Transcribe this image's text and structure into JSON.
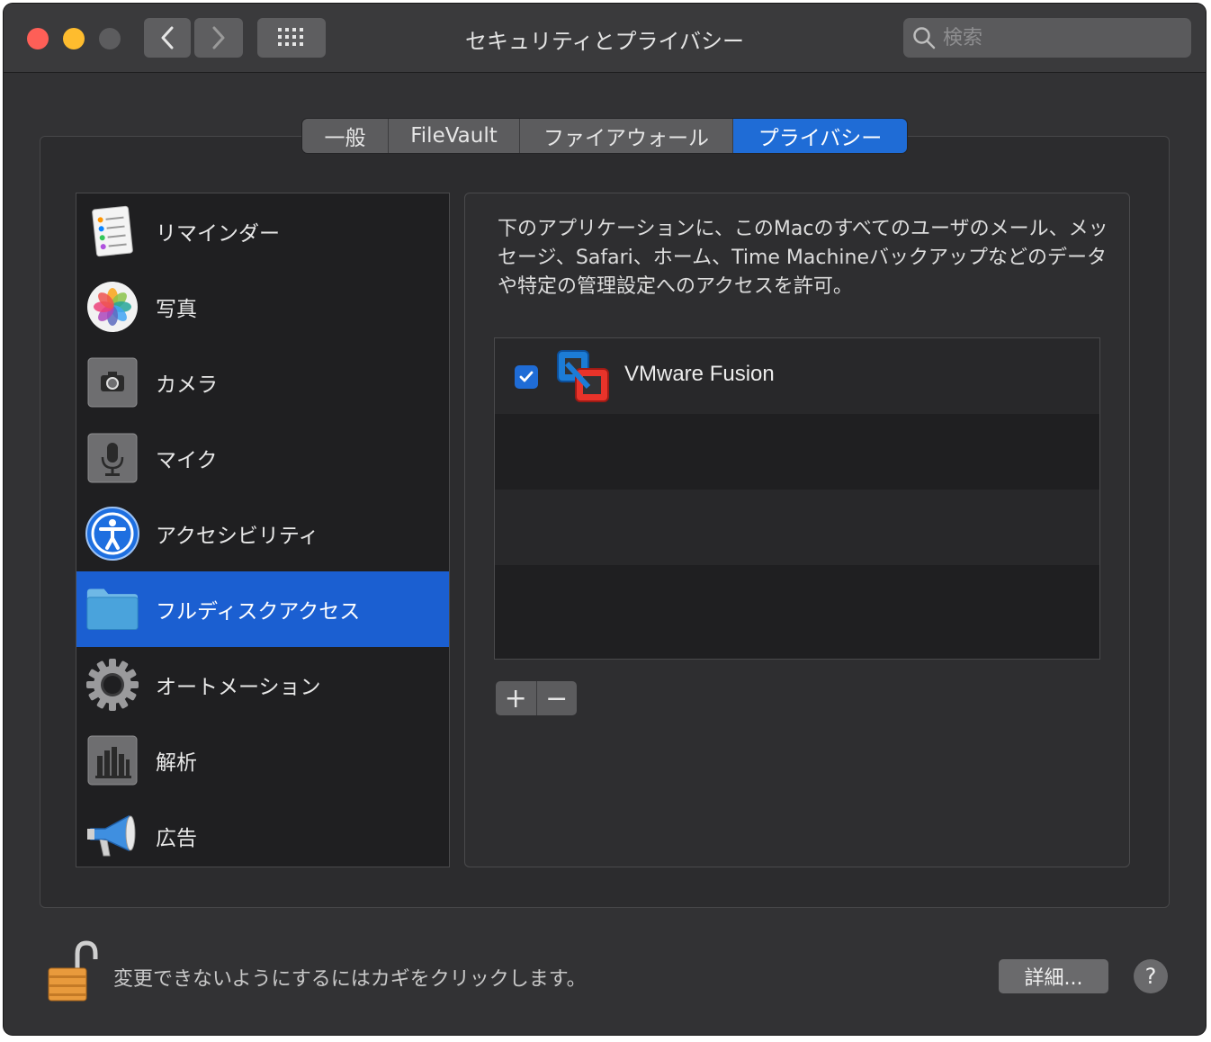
{
  "window": {
    "title": "セキュリティとプライバシー"
  },
  "search": {
    "placeholder": "検索"
  },
  "tabs": [
    {
      "label": "一般"
    },
    {
      "label": "FileVault"
    },
    {
      "label": "ファイアウォール"
    },
    {
      "label": "プライバシー",
      "active": true
    }
  ],
  "sidebar": {
    "items": [
      {
        "label": "リマインダー",
        "icon": "reminders-icon"
      },
      {
        "label": "写真",
        "icon": "photos-icon"
      },
      {
        "label": "カメラ",
        "icon": "camera-icon"
      },
      {
        "label": "マイク",
        "icon": "microphone-icon"
      },
      {
        "label": "アクセシビリティ",
        "icon": "accessibility-icon"
      },
      {
        "label": "フルディスクアクセス",
        "icon": "folder-icon",
        "selected": true
      },
      {
        "label": "オートメーション",
        "icon": "gear-icon"
      },
      {
        "label": "解析",
        "icon": "analytics-icon"
      },
      {
        "label": "広告",
        "icon": "megaphone-icon"
      }
    ]
  },
  "panel": {
    "description": "下のアプリケーションに、このMacのすべてのユーザのメール、メッセージ、Safari、ホーム、Time Machineバックアップなどのデータや特定の管理設定へのアクセスを許可。",
    "apps": [
      {
        "name": "VMware Fusion",
        "checked": true,
        "icon": "vmware-fusion-icon"
      }
    ],
    "add_label": "+",
    "remove_label": "−"
  },
  "footer": {
    "lock_text": "変更できないようにするにはカギをクリックします。",
    "advanced_label": "詳細...",
    "help_label": "?"
  },
  "colors": {
    "accent": "#1f6cd6",
    "selection": "#1b5fd1"
  }
}
